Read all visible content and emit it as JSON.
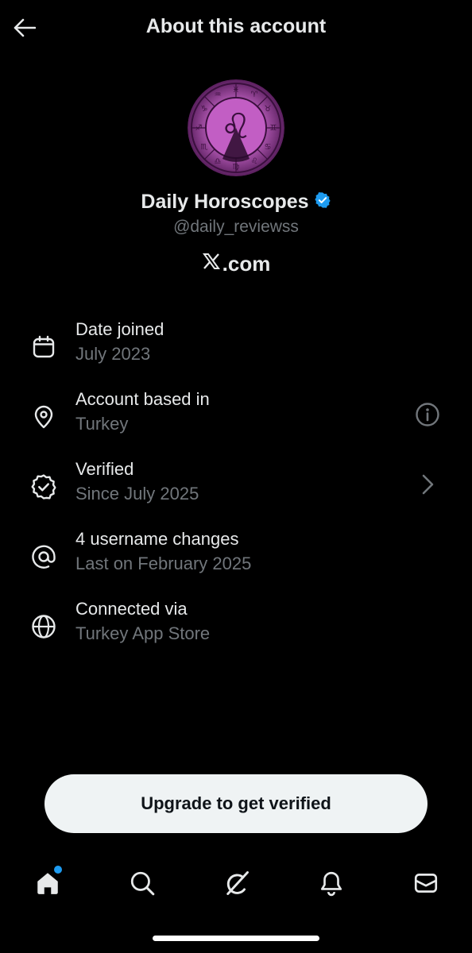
{
  "header": {
    "title": "About this account"
  },
  "profile": {
    "name": "Daily Horoscopes",
    "handle": "@daily_reviewss",
    "domain_text": ".com",
    "verified_color": "#1d9bf0"
  },
  "details": [
    {
      "label": "Date joined",
      "value": "July 2023",
      "icon": "calendar-icon"
    },
    {
      "label": "Account based in",
      "value": "Turkey",
      "icon": "location-pin-icon",
      "right_icon": "info-icon"
    },
    {
      "label": "Verified",
      "value": "Since July 2025",
      "icon": "verified-badge-icon",
      "right_icon": "chevron-right-icon"
    },
    {
      "label": "4 username changes",
      "value": "Last on February 2025",
      "icon": "at-sign-icon"
    },
    {
      "label": "Connected via",
      "value": "Turkey App Store",
      "icon": "globe-icon"
    }
  ],
  "cta": {
    "label": "Upgrade to get verified"
  },
  "tabs": [
    "home-icon",
    "search-icon",
    "grok-icon",
    "notifications-icon",
    "messages-icon"
  ],
  "colors": {
    "background": "#000000",
    "text": "#e7e9ea",
    "secondary": "#71767b",
    "accent": "#1d9bf0"
  }
}
